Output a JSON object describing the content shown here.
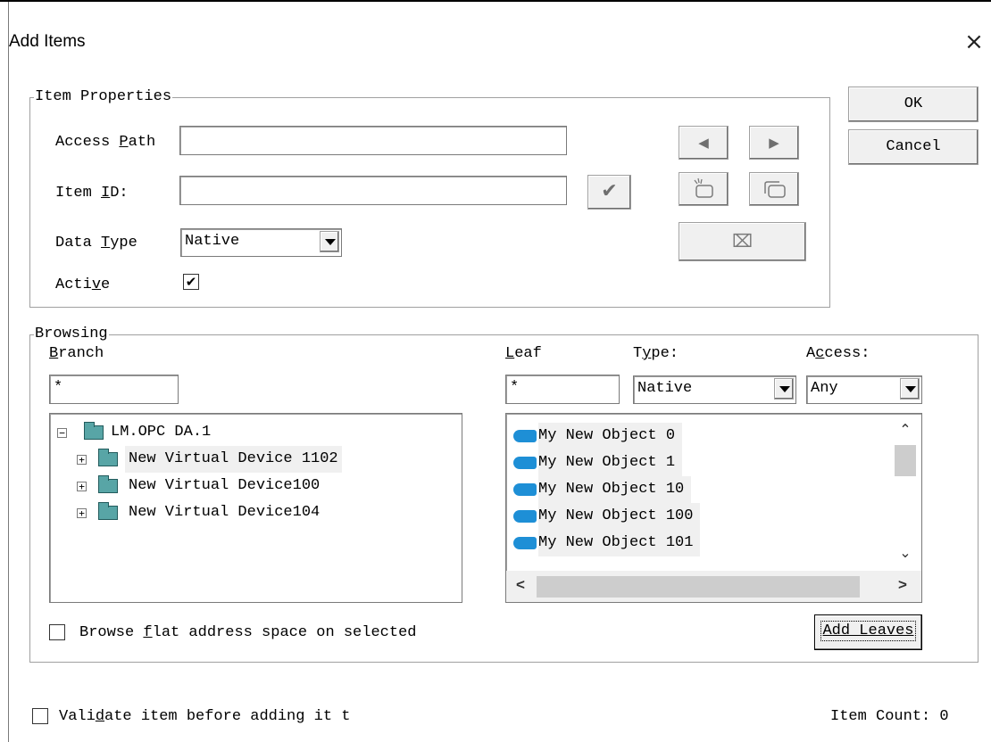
{
  "window": {
    "title": "Add Items",
    "close_icon": "×"
  },
  "buttons": {
    "ok": "OK",
    "cancel": "Cancel",
    "add_leaves": "Add Leaves"
  },
  "item_properties": {
    "group_label": "Item Properties",
    "access_path": {
      "label_pre": "Access ",
      "label_u": "P",
      "label_post": "ath",
      "value": ""
    },
    "item_id": {
      "label_pre": "Item ",
      "label_u": "I",
      "label_post": "D:",
      "value": ""
    },
    "data_type": {
      "label_pre": "Data ",
      "label_u": "T",
      "label_post": "ype",
      "value": "Native"
    },
    "active": {
      "label_pre": "Acti",
      "label_u": "v",
      "label_post": "e",
      "checked": "✔"
    }
  },
  "browsing": {
    "group_label": "Browsing",
    "branch": {
      "label_u": "B",
      "label_post": "ranch",
      "filter": "*"
    },
    "leaf": {
      "label_u": "L",
      "label_post": "eaf",
      "filter": "*"
    },
    "type": {
      "label_pre": "T",
      "label_u": "y",
      "label_post": "pe:",
      "value": "Native"
    },
    "access": {
      "label_pre": "A",
      "label_u": "c",
      "label_post": "cess:",
      "value": "Any"
    },
    "tree": [
      {
        "label": "LM.OPC DA.1",
        "expander": "−"
      },
      {
        "label": "New Virtual Device 1102",
        "expander": "+"
      },
      {
        "label": "New Virtual Device100",
        "expander": "+"
      },
      {
        "label": "New Virtual Device104",
        "expander": "+"
      }
    ],
    "leaves": [
      "My New Object 0",
      "My New Object 1",
      "My New Object 10",
      "My New Object 100",
      "My New Object 101"
    ],
    "flat": {
      "label_pre": "Browse ",
      "label_u": "f",
      "label_post": "lat address space on selected"
    }
  },
  "footer": {
    "validate": {
      "label_pre": "Vali",
      "label_u": "d",
      "label_post": "ate item before adding it t"
    },
    "item_count": "Item Count: 0"
  },
  "icons": {
    "prev": "◀",
    "next": "▶",
    "check": "✔",
    "delete": "⌧",
    "scroll_up": "⌃",
    "scroll_down": "⌄",
    "scroll_left": "<",
    "scroll_right": ">"
  },
  "colors": {
    "folder": "#58a5a6",
    "leaf": "#1e8fd6",
    "check": "#6f6f6f"
  }
}
